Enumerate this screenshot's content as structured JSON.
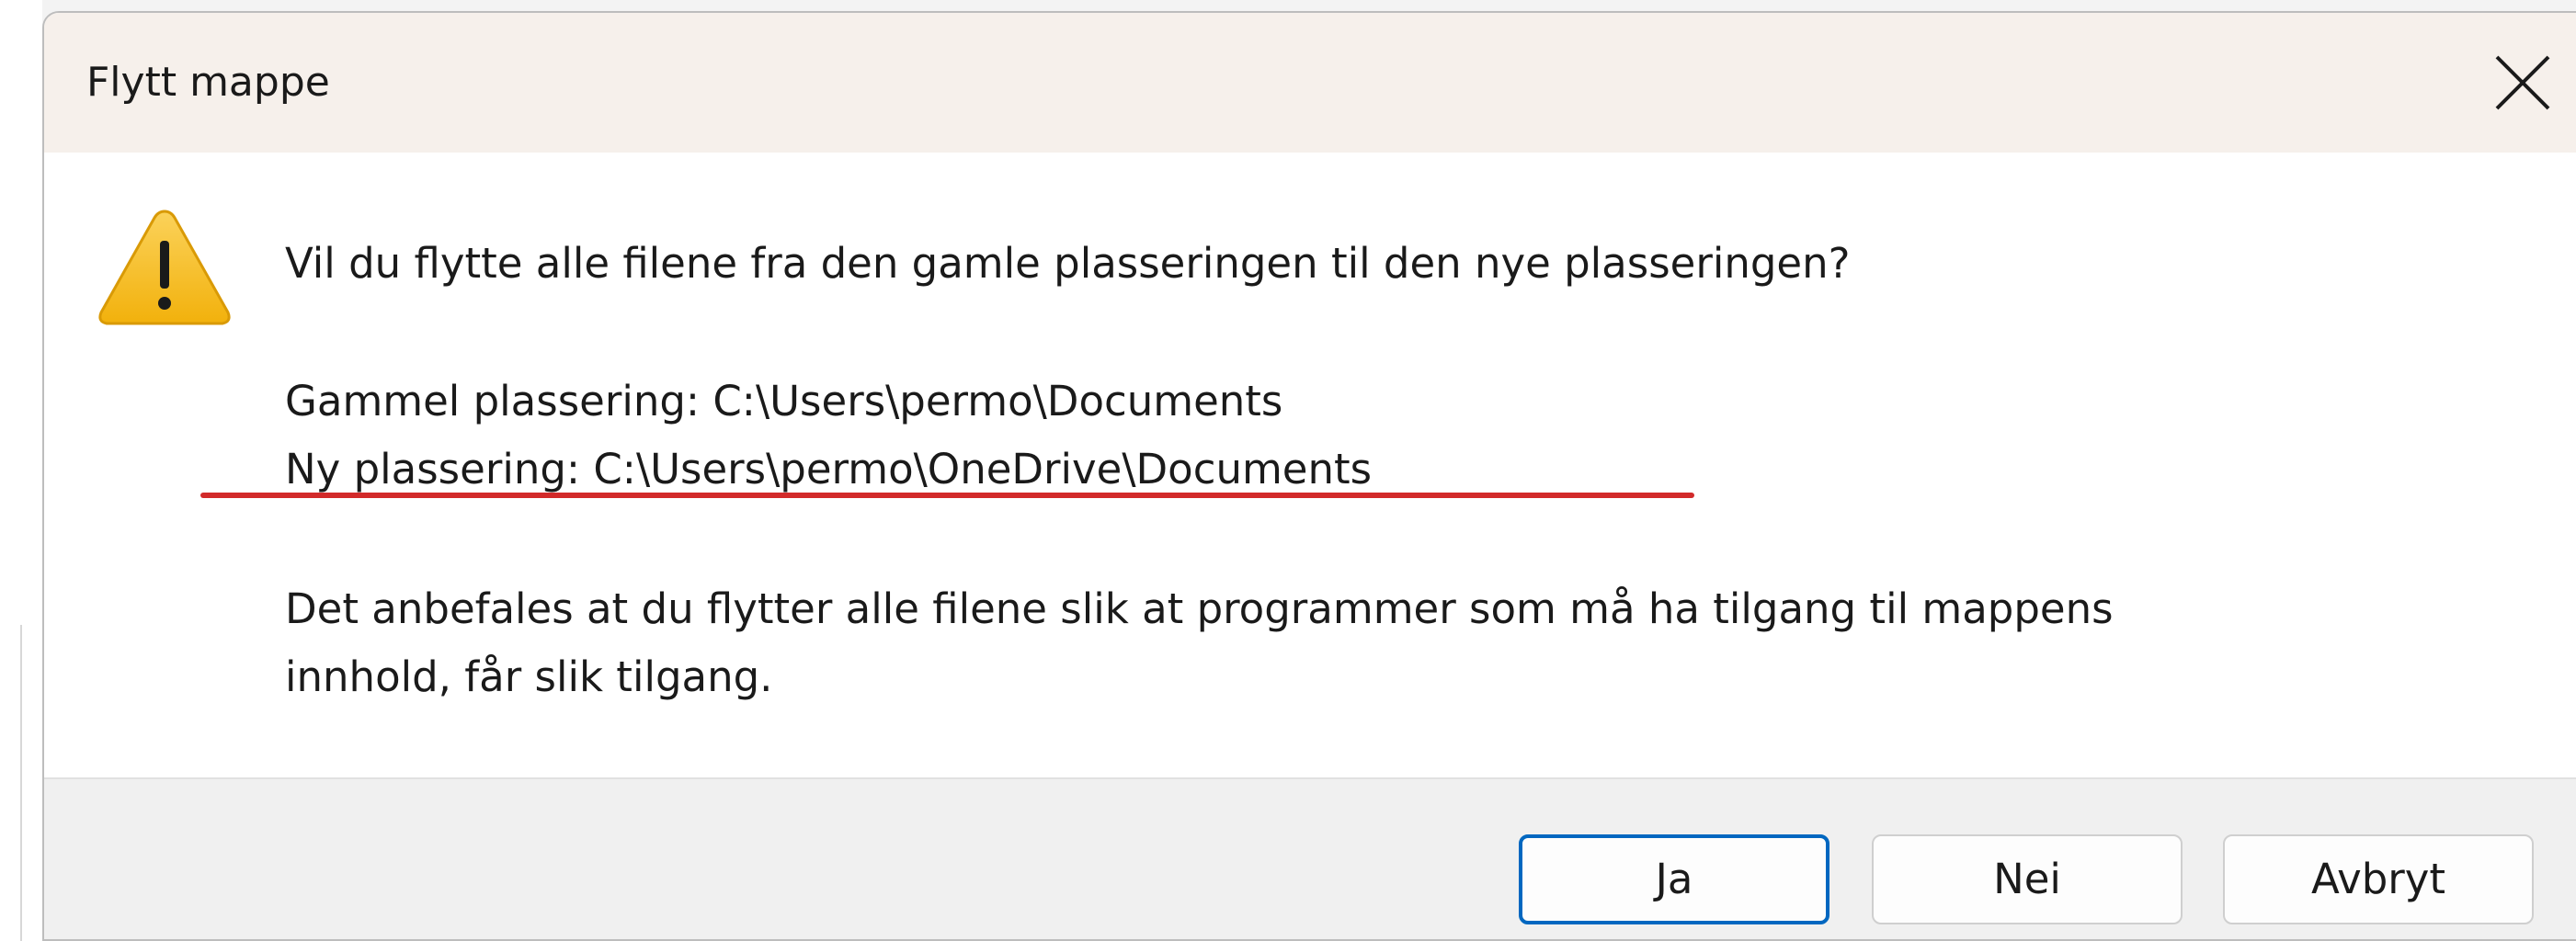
{
  "dialog": {
    "title": "Flytt mappe",
    "close_icon": "close-icon",
    "warning_icon": "warning-triangle-icon",
    "question": "Vil du flytte alle filene fra den gamle plasseringen til den nye plasseringen?",
    "old_location": "Gammel plassering: C:\\Users\\permo\\Documents",
    "new_location": "Ny plassering: C:\\Users\\permo\\OneDrive\\Documents",
    "recommendation_line1": "Det anbefales at du flytter alle filene slik at programmer som må ha tilgang til mappens",
    "recommendation_line2": "innhold, får slik tilgang.",
    "annotation_color": "#d22a2a"
  },
  "buttons": {
    "yes": "Ja",
    "no": "Nei",
    "cancel": "Avbryt"
  },
  "colors": {
    "titlebar": "#f6f0eb",
    "footer": "#f0f0f0",
    "accent": "#0067c0",
    "warning": "#f8c21c"
  }
}
